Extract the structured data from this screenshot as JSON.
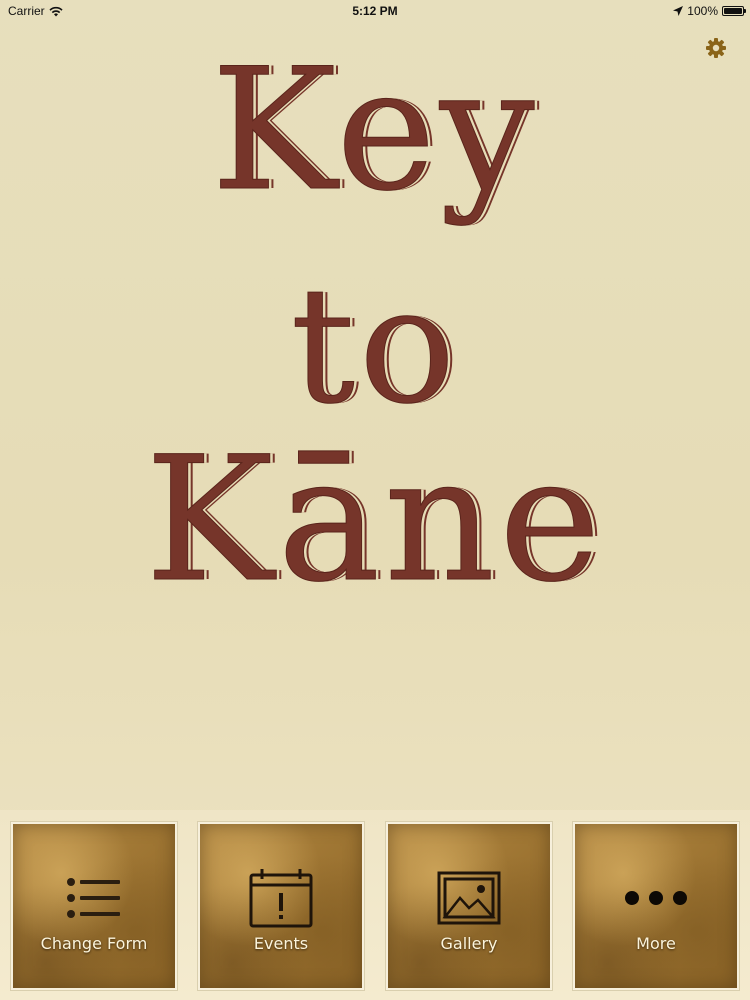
{
  "status_bar": {
    "carrier": "Carrier",
    "time": "5:12 PM",
    "battery": "100%",
    "icons": [
      "wifi-icon",
      "location-arrow-icon",
      "battery-icon"
    ]
  },
  "header": {
    "settings_icon": "gear-icon",
    "settings_color": "#8a6418"
  },
  "title": {
    "line1": "Key",
    "line2": "to",
    "line3": "Kāne",
    "color": "#76352a"
  },
  "nav": {
    "items": [
      {
        "label": "Change Form",
        "icon": "list-icon"
      },
      {
        "label": "Events",
        "icon": "calendar-alert-icon"
      },
      {
        "label": "Gallery",
        "icon": "image-icon"
      },
      {
        "label": "More",
        "icon": "more-dots-icon"
      }
    ]
  }
}
